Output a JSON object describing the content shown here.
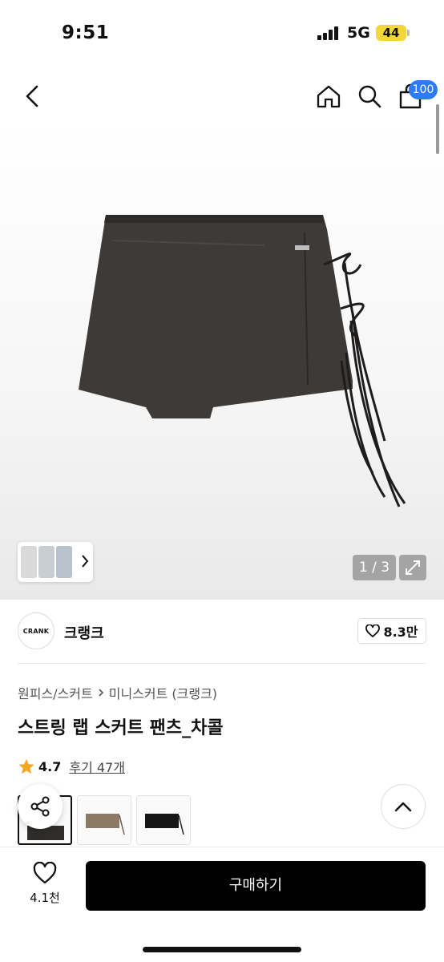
{
  "status_bar": {
    "time": "9:51",
    "network": "5G",
    "battery": "44"
  },
  "nav": {
    "cart_count": "100"
  },
  "gallery": {
    "counter": "1 / 3"
  },
  "brand": {
    "logo_text": "CRANK",
    "name": "크랭크",
    "likes": "8.3만"
  },
  "breadcrumb": {
    "category": "원피스/스커트",
    "subcategory": "미니스커트 (크랭크)"
  },
  "product": {
    "title": "스트링 랩 스커트 팬츠_차콜",
    "rating": "4.7",
    "reviews": "후기 47개"
  },
  "bottom_bar": {
    "wish_count": "4.1천",
    "buy_label": "구매하기"
  },
  "colors": {
    "cart_badge": "#2f7bf4",
    "star": "#f5a623",
    "battery": "#f2d73a"
  }
}
